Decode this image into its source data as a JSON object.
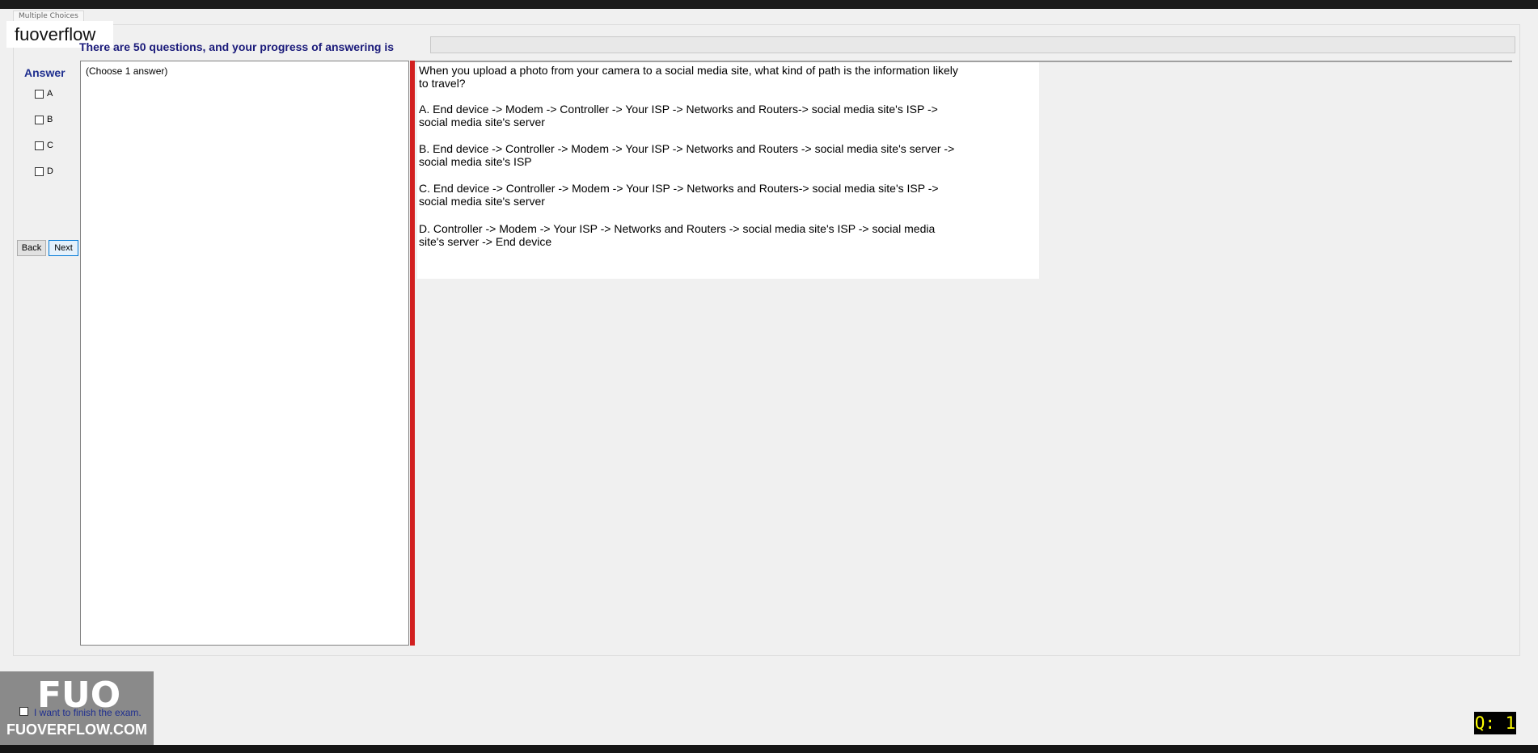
{
  "window": {
    "tab_title": "Multiple Choices"
  },
  "brand": {
    "label": "fuoverflow"
  },
  "progress": {
    "text": "There are 50 questions, and your progress of answering is",
    "fill_fraction": 0
  },
  "answer_panel": {
    "title": "Answer",
    "options": [
      {
        "label": "A",
        "checked": false
      },
      {
        "label": "B",
        "checked": false
      },
      {
        "label": "C",
        "checked": false
      },
      {
        "label": "D",
        "checked": false
      }
    ],
    "back_label": "Back",
    "next_label": "Next"
  },
  "choose_panel": {
    "instruction": "(Choose 1 answer)"
  },
  "question": {
    "stem_line1": "When you upload a photo from your camera to a social media site, what kind of path is the information likely",
    "stem_line2": "to travel?",
    "options": [
      {
        "line1": "A.  End device -> Modem -> Controller -> Your ISP -> Networks and Routers-> social media site's ISP ->",
        "line2": "social media site's server"
      },
      {
        "line1": "B.  End device -> Controller -> Modem -> Your ISP -> Networks and Routers -> social media site's server ->",
        "line2": "social media site's ISP"
      },
      {
        "line1": "C.  End device -> Controller -> Modem -> Your ISP -> Networks and Routers-> social media site's ISP ->",
        "line2": "social media site's server"
      },
      {
        "line1": "D.  Controller -> Modem -> Your ISP -> Networks and Routers -> social media site's ISP -> social media",
        "line2": "site's server -> End device"
      }
    ]
  },
  "footer": {
    "logo_mark": "FUO",
    "logo_text": "FUOVERFLOW.COM",
    "finish_label": "I want to finish the exam.",
    "q_counter": "Q: 1"
  },
  "colors": {
    "splitter": "#d22020",
    "title_blue": "#1f2f8f",
    "counter_text": "#ffff00"
  }
}
